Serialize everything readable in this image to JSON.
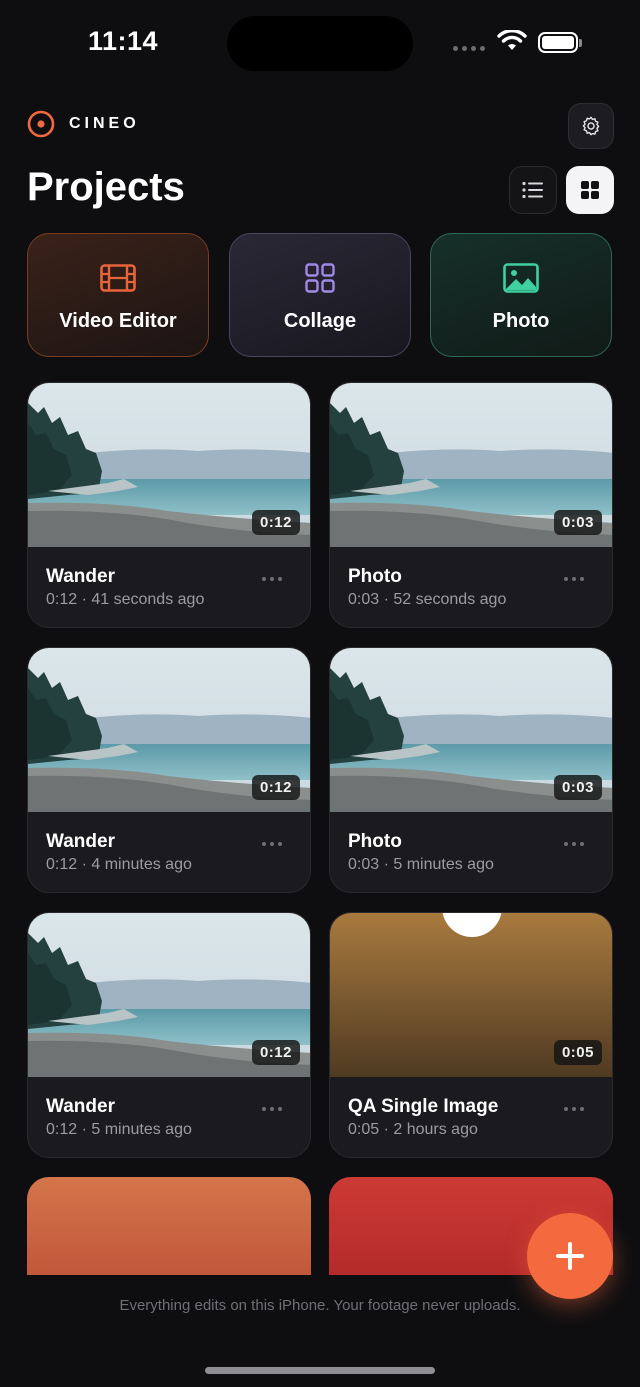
{
  "status_bar": {
    "time": "11:14"
  },
  "header": {
    "brand": "CINEO",
    "title": "Projects"
  },
  "modes": [
    {
      "label": "Video Editor",
      "icon": "film-icon",
      "color": "#e8643a"
    },
    {
      "label": "Collage",
      "icon": "grid-icon",
      "color": "#a08ae8"
    },
    {
      "label": "Photo",
      "icon": "image-icon",
      "color": "#3fd0a0"
    }
  ],
  "projects": [
    {
      "name": "Wander",
      "meta": "0:12 · 41 seconds ago",
      "duration": "0:12",
      "thumbnail": "beach"
    },
    {
      "name": "Photo",
      "meta": "0:03 · 52 seconds ago",
      "duration": "0:03",
      "thumbnail": "beach"
    },
    {
      "name": "Wander",
      "meta": "0:12 · 4 minutes ago",
      "duration": "0:12",
      "thumbnail": "beach"
    },
    {
      "name": "Photo",
      "meta": "0:03 · 5 minutes ago",
      "duration": "0:03",
      "thumbnail": "beach"
    },
    {
      "name": "Wander",
      "meta": "0:12 · 5 minutes ago",
      "duration": "0:12",
      "thumbnail": "beach"
    },
    {
      "name": "QA Single Image",
      "meta": "0:05 · 2 hours ago",
      "duration": "0:05",
      "thumbnail": "brown-gradient"
    }
  ],
  "footer": {
    "text": "Everything edits on this iPhone. Your footage never uploads."
  },
  "colors": {
    "accent": "#f26a3d",
    "background": "#0e0e10",
    "card": "#1b1b1f"
  }
}
